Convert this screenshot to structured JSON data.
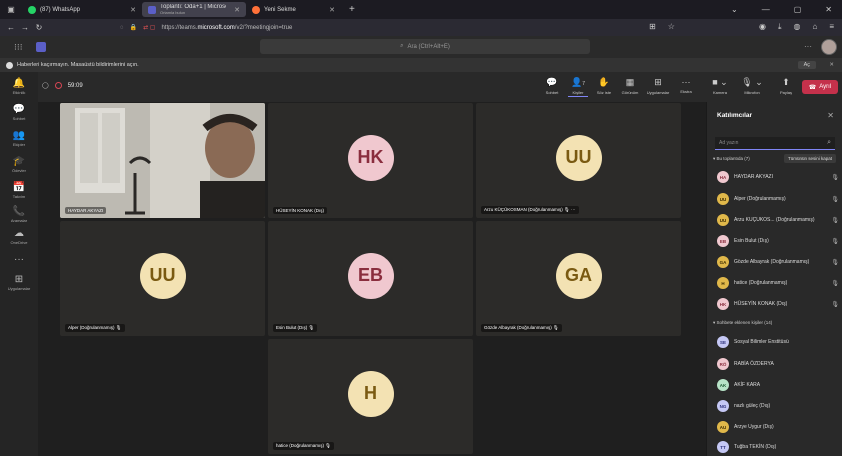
{
  "browser": {
    "tabs": [
      {
        "label": "(87) WhatsApp",
        "sub": "",
        "active": false
      },
      {
        "label": "Toplantı: Oda+1 | Microsoft Te",
        "sub": "Ortamla bulun",
        "active": true
      },
      {
        "label": "Yeni Sekme",
        "sub": "",
        "active": false
      }
    ],
    "url_prefix": "https://teams.",
    "url_host": "microsoft.com",
    "url_rest": "/v2/?meetingjoin=true"
  },
  "teams": {
    "search_placeholder": "Ara (Ctrl+Alt+E)"
  },
  "notice": {
    "text": "Haberleri kaçırmayın. Masaüstü bildirimlerini açın.",
    "button": "Aç"
  },
  "rail": [
    {
      "icon": "bell-icon",
      "glyph": "🔔",
      "label": "Etkinlik"
    },
    {
      "icon": "chat-icon",
      "glyph": "💬",
      "label": "Sohbet"
    },
    {
      "icon": "teams-icon",
      "glyph": "👥",
      "label": "Ekipler"
    },
    {
      "icon": "assignments-icon",
      "glyph": "🎓",
      "label": "Ödevler"
    },
    {
      "icon": "calendar-icon",
      "glyph": "📅",
      "label": "Takvim"
    },
    {
      "icon": "calls-icon",
      "glyph": "📞",
      "label": "Aramalar"
    },
    {
      "icon": "onedrive-icon",
      "glyph": "☁",
      "label": "OneDrive"
    },
    {
      "icon": "more-icon",
      "glyph": "···",
      "label": ""
    },
    {
      "icon": "apps-icon",
      "glyph": "⊞",
      "label": "Uygulamalar"
    }
  ],
  "meeting": {
    "time": "59:09",
    "tools": [
      {
        "label": "Sohbet",
        "glyph": "💬"
      },
      {
        "label": "Kişiler",
        "glyph": "👤",
        "badge": "7"
      },
      {
        "label": "Söz iste",
        "glyph": "✋"
      },
      {
        "label": "Görünüm",
        "glyph": "▦"
      },
      {
        "label": "Uygulamalar",
        "glyph": "⊞"
      },
      {
        "label": "Ekstra",
        "glyph": "···"
      }
    ],
    "camera": "Kamera",
    "mic": "Mikrofon",
    "share": "Paylaş",
    "leave": "Ayrıl"
  },
  "tiles": [
    {
      "initials": "",
      "name": "HAYDAR AKYAZI",
      "video": true
    },
    {
      "initials": "HK",
      "name": "HÜSEYİN KONAK (Dış)",
      "bg": "#f0c8cf",
      "fg": "#8a2e3e"
    },
    {
      "initials": "UU",
      "name": "Arzu KÜÇÜKOSMAN (Doğrulanmamış)",
      "bg": "#f3e2b3",
      "fg": "#7a5a12"
    },
    {
      "initials": "UU",
      "name": "Alper (Doğrulanmamış)",
      "bg": "#f3e2b3",
      "fg": "#7a5a12"
    },
    {
      "initials": "EB",
      "name": "Esin Bulut (Dış)",
      "bg": "#f0c8cf",
      "fg": "#8a2e3e"
    },
    {
      "initials": "GA",
      "name": "Gözde Albayrak (Doğrulanmamış)",
      "bg": "#f3e2b3",
      "fg": "#7a5a12"
    },
    {
      "initials": "H",
      "name": "hatice (Doğrulanmamış)",
      "bg": "#f3e2b3",
      "fg": "#7a5a12"
    }
  ],
  "panel": {
    "title": "Katılımcılar",
    "search_placeholder": "Ad yazın",
    "in_meeting": "Bu toplantıda (7)",
    "mute_all": "Tümünün sesini kapat",
    "invited": "Sohbete eklenen kişiler (14)",
    "in_meeting_people": [
      {
        "initials": "HA",
        "name": "HAYDAR AKYAZI",
        "bg": "#f0c8cf",
        "fg": "#8a2e3e"
      },
      {
        "initials": "UU",
        "name": "Alper (Doğrulanmamış)",
        "bg": "#e0b84a",
        "fg": "#3a2a00"
      },
      {
        "initials": "UU",
        "name": "Arzu KÜÇÜKOS... (Doğrulanmamış)",
        "bg": "#e0b84a",
        "fg": "#3a2a00"
      },
      {
        "initials": "EB",
        "name": "Esin Bulut (Dış)",
        "bg": "#f0c8cf",
        "fg": "#8a2e3e"
      },
      {
        "initials": "GA",
        "name": "Gözde Albayrak (Doğrulanmamış)",
        "bg": "#e0b84a",
        "fg": "#3a2a00"
      },
      {
        "initials": "H",
        "name": "hatice (Doğrulanmamış)",
        "bg": "#e0b84a",
        "fg": "#3a2a00"
      },
      {
        "initials": "HK",
        "name": "HÜSEYİN KONAK (Dış)",
        "bg": "#f0c8cf",
        "fg": "#8a2e3e"
      }
    ],
    "invited_people": [
      {
        "initials": "SE",
        "name": "Sosyal Bilimler Enstitüsü",
        "bg": "#c5c8f5",
        "fg": "#2b2f7a"
      },
      {
        "initials": "RÖ",
        "name": "RABİA ÖZDERYA",
        "bg": "#f0c8cf",
        "fg": "#8a2e3e"
      },
      {
        "initials": "AK",
        "name": "AKİF KARA",
        "bg": "#b7e3c7",
        "fg": "#1d5a33"
      },
      {
        "initials": "NG",
        "name": "nazlı güleç (Dış)",
        "bg": "#c5c8f5",
        "fg": "#2b2f7a"
      },
      {
        "initials": "AU",
        "name": "Arzye Uygur (Dış)",
        "bg": "#e0b84a",
        "fg": "#3a2a00"
      },
      {
        "initials": "TT",
        "name": "Tuğba TEKİN (Dış)",
        "bg": "#c5c8f5",
        "fg": "#2b2f7a"
      }
    ]
  }
}
